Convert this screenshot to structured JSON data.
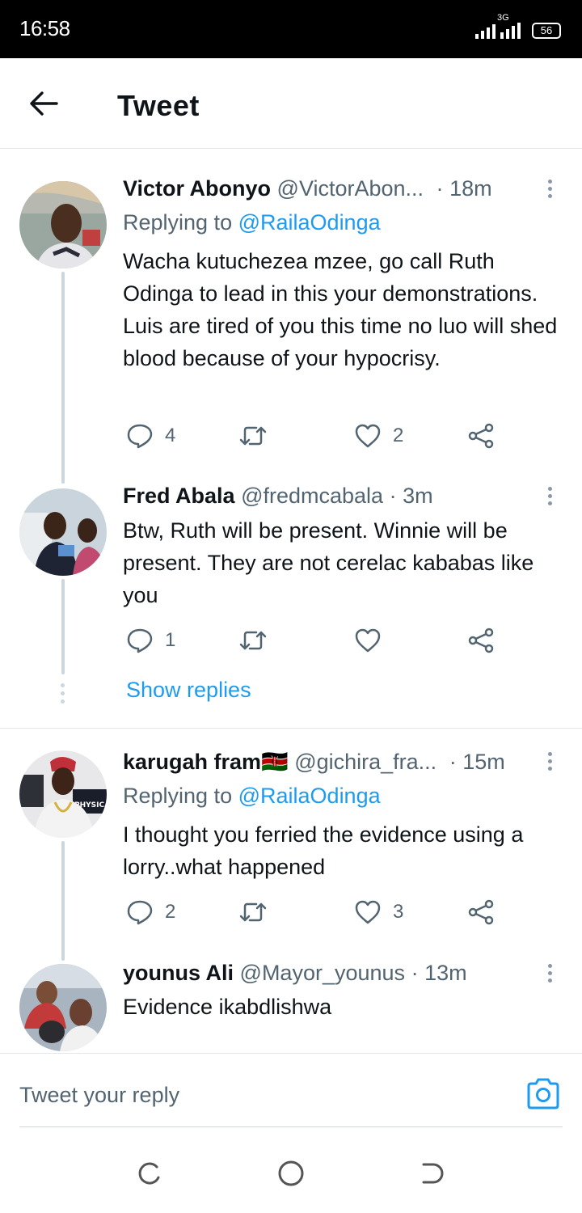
{
  "status": {
    "time": "16:58",
    "network": "3G",
    "battery": "56"
  },
  "header": {
    "title": "Tweet",
    "back_icon": "arrow-left-icon"
  },
  "colors": {
    "link": "#1d9bf0",
    "muted": "#536471",
    "thread_line": "#ccd6dd"
  },
  "tweets": [
    {
      "name": "Victor Abonyo",
      "handle": "@VictorAbon...",
      "dot": "·",
      "time": "18m",
      "replying_prefix": "Replying to",
      "replying_to": "@RailaOdinga",
      "text": "Wacha kutuchezea mzee, go call Ruth Odinga to lead in this your demonstrations. Luis are tired of you this time no luo will shed blood because of your hypocrisy.",
      "replies": "4",
      "retweets": "",
      "likes": "2"
    },
    {
      "name": "Fred Abala",
      "handle": "@fredmcabala",
      "dot": "·",
      "time": "3m",
      "text": "Btw, Ruth will be present. Winnie will be present. They are not cerelac kababas like you",
      "replies": "1",
      "retweets": "",
      "likes": ""
    },
    {
      "name": "karugah fram",
      "flag": "🇰🇪",
      "handle": "@gichira_fra...",
      "dot": "·",
      "time": "15m",
      "replying_prefix": "Replying to",
      "replying_to": "@RailaOdinga",
      "text": "I thought you ferried the evidence using a lorry..what happened",
      "replies": "2",
      "retweets": "",
      "likes": "3"
    },
    {
      "name": "younus Ali",
      "handle": "@Mayor_younus",
      "dot": "·",
      "time": "13m",
      "text": "Evidence ikabdlishwa"
    }
  ],
  "show_replies": "Show replies",
  "reply_bar": {
    "placeholder": "Tweet your reply",
    "camera_icon": "camera-icon"
  }
}
